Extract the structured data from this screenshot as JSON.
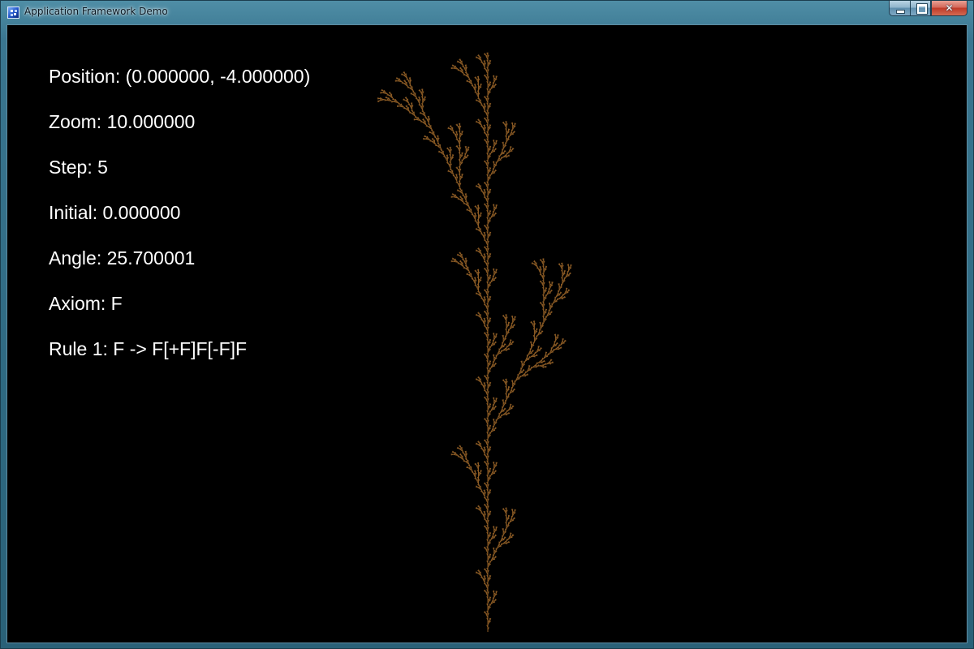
{
  "window": {
    "title": "Application Framework Demo",
    "app_icon": "app-icon",
    "controls": {
      "minimize_icon": "minimize-icon",
      "maximize_icon": "maximize-icon",
      "close_icon": "close-icon",
      "close_glyph": "✕"
    }
  },
  "stats": {
    "position": "Position: (0.000000, -4.000000)",
    "zoom": "Zoom: 10.000000",
    "step": "Step: 5",
    "initial": "Initial: 0.000000",
    "angle": "Angle: 25.700001",
    "axiom": "Axiom: F",
    "rule1": "Rule 1: F -> F[+F]F[-F]F"
  },
  "lsystem": {
    "axiom": "F",
    "rule_from": "F",
    "rule_to": "F[+F]F[-F]F",
    "angle_deg": 25.7,
    "initial_deg": 0,
    "steps": 5,
    "colors": {
      "branch": "#8a5a24",
      "background": "#000000",
      "text": "#ffffff"
    }
  }
}
